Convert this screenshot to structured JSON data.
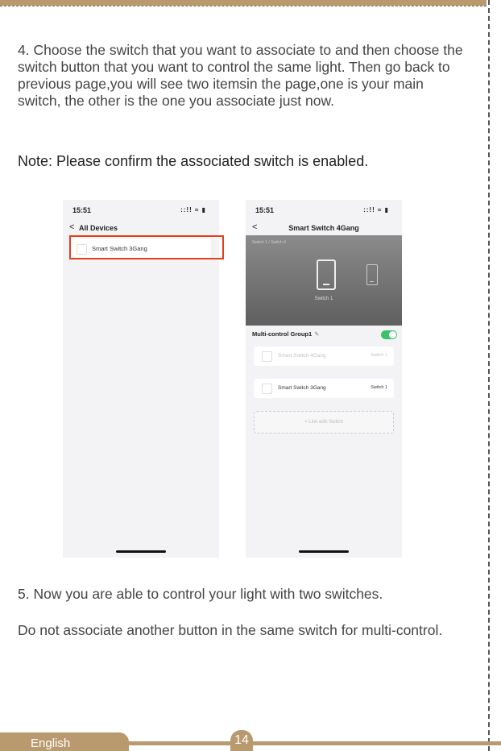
{
  "instructions": {
    "step4": "4. Choose the switch that you want to associate to and then choose the switch button that you want to control the same light. Then go back to previous page,you will see two itemsin the page,one is your main switch, the other is the one you associate just now.",
    "note": "Note: Please confirm the associated switch is enabled.",
    "step5_line1": "5. Now you are able to control your light with two switches.",
    "step5_line2": "Do not associate another button in the same switch for multi-control."
  },
  "screenshot_left": {
    "time": "15:51",
    "status_icons": "::!! ≈ ▮",
    "back": "<",
    "title": "All Devices",
    "device": "Smart Switch 3Gang"
  },
  "screenshot_right": {
    "time": "15:51",
    "status_icons": "::!! ≈ ▮",
    "back": "<",
    "title": "Smart Switch 4Gang",
    "hero_small": "Switch 1 / Switch 4",
    "hero_label": "Switch 1",
    "group_label": "Multi-control Group1",
    "group_enabled": true,
    "devices": [
      {
        "name": "Smart Switch 4Gang",
        "switch": "Switch 1",
        "dimmed": true
      },
      {
        "name": "Smart Switch 3Gang",
        "switch": "Switch 1",
        "dimmed": false
      }
    ],
    "link_button": "+ Link with Switch"
  },
  "footer": {
    "language": "English",
    "page_number": "14"
  },
  "colors": {
    "accent": "#b99a6e",
    "highlight": "#e2401c",
    "toggle_on": "#3cc26a"
  }
}
